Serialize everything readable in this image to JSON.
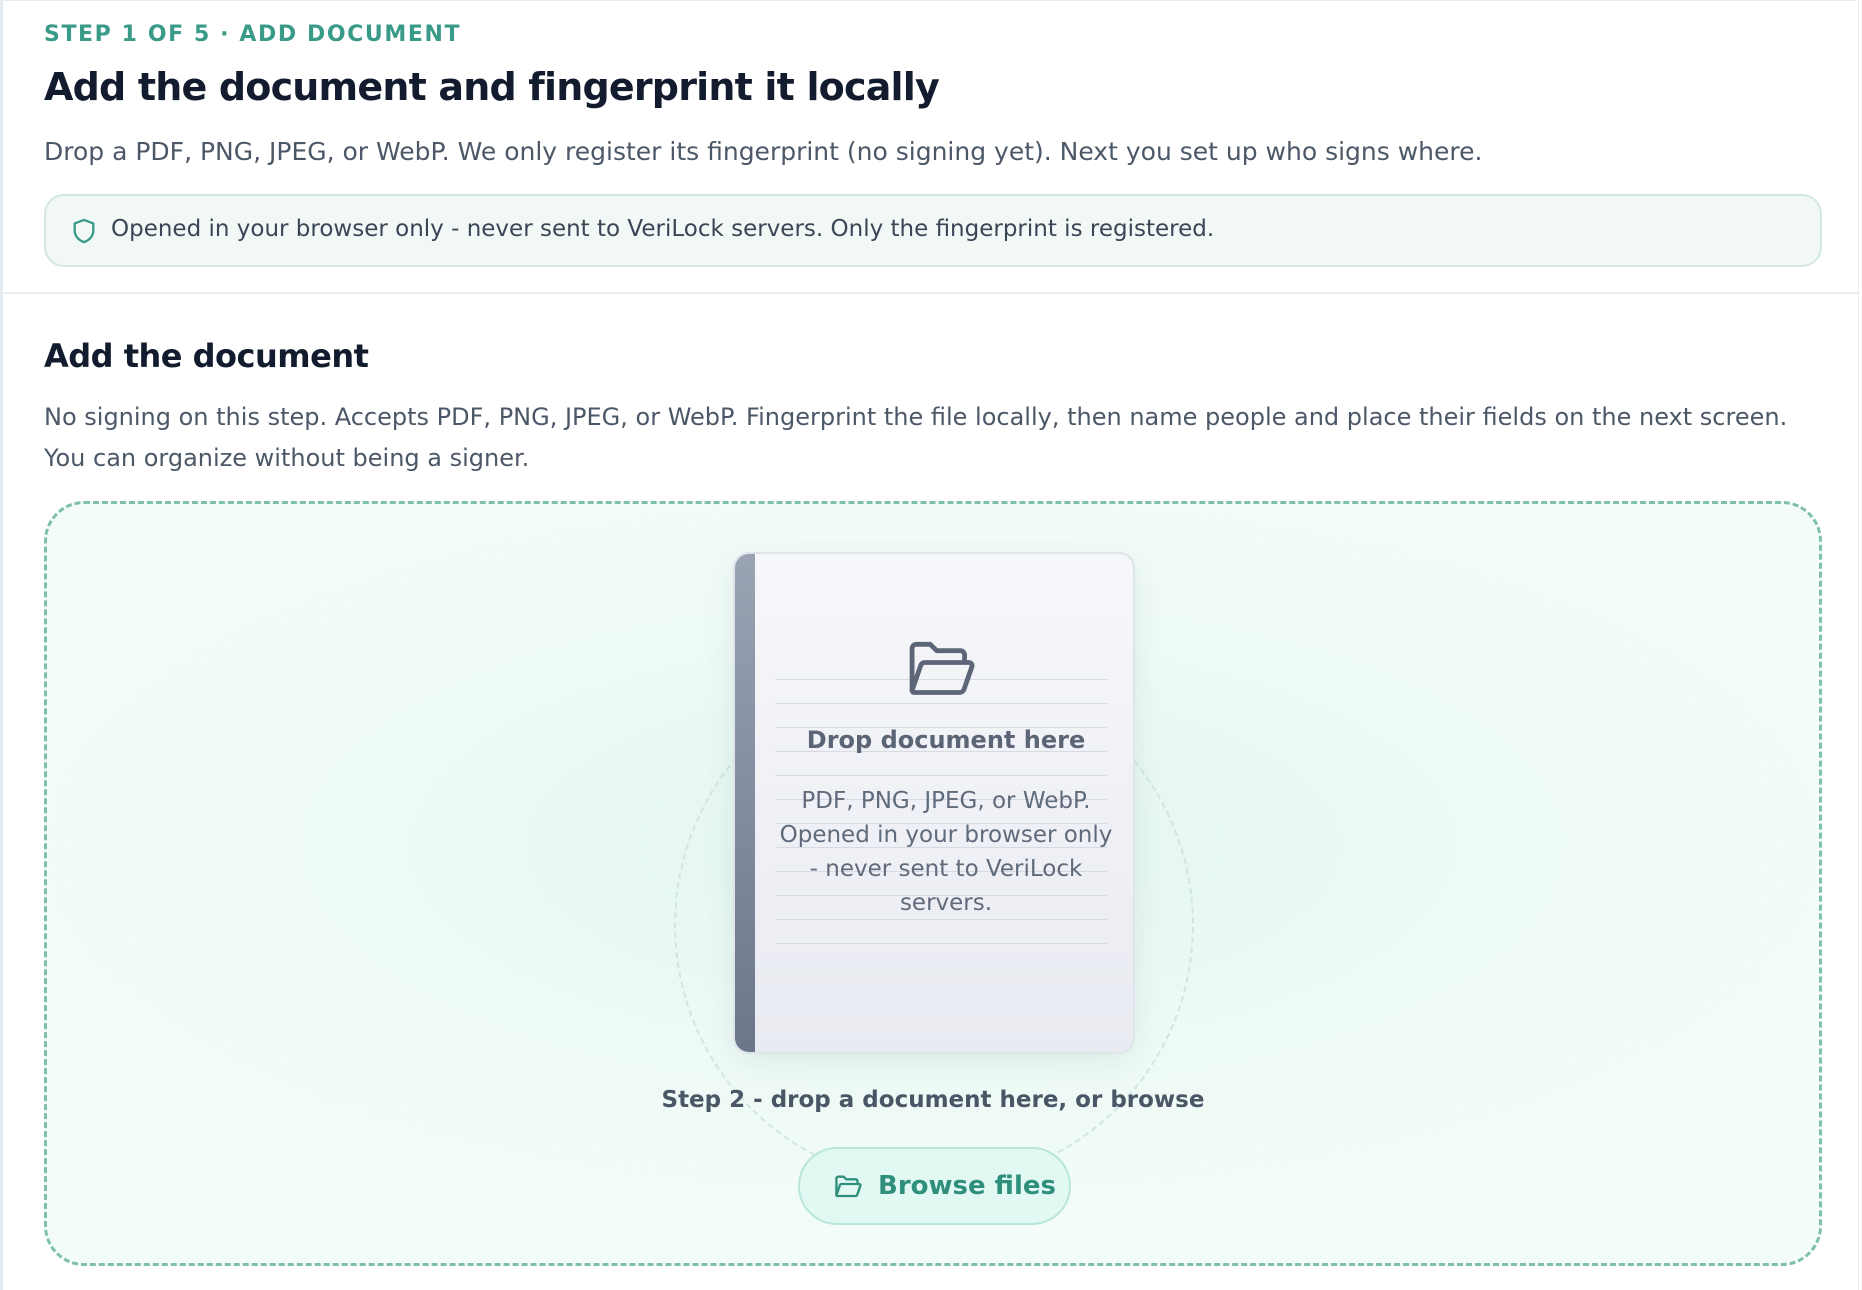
{
  "header": {
    "step_label": "STEP 1 OF 5 · ADD DOCUMENT",
    "title": "Add the document and fingerprint it locally",
    "subtitle": "Drop a PDF, PNG, JPEG, or WebP. We only register its fingerprint (no signing yet). Next you set up who signs where.",
    "notice": {
      "icon": "shield-icon",
      "text": "Opened in your browser only - never sent to VeriLock servers. Only the fingerprint is registered."
    }
  },
  "section": {
    "title": "Add the document",
    "description": "No signing on this step. Accepts PDF, PNG, JPEG, or WebP. Fingerprint the file locally, then name people and place their fields on the next screen. You can organize without being a signer."
  },
  "dropzone": {
    "icon": "folder-open-icon",
    "title": "Drop document here",
    "hint": "PDF, PNG, JPEG, or WebP. Opened in your browser only - never sent to VeriLock servers.",
    "step_text": "Step 2 - drop a document here, or browse",
    "browse_button": {
      "icon": "folder-open-icon",
      "label": "Browse files"
    }
  },
  "colors": {
    "accent": "#3a9a88",
    "title": "#121c2e",
    "body_text": "#4c5868",
    "dropzone_border": "#7fbfb0",
    "dropzone_bg": "#eefaf6",
    "button_bg": "#e2f8f2"
  }
}
